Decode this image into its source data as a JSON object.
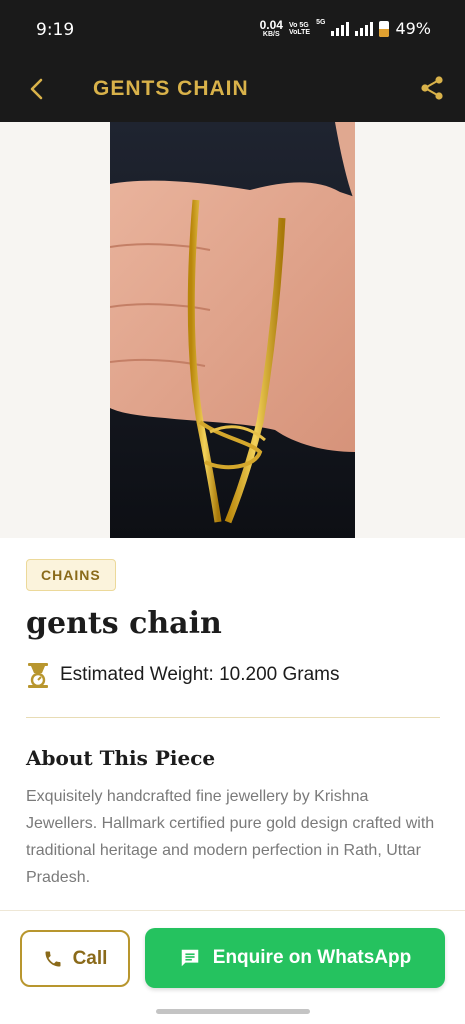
{
  "status_bar": {
    "time": "9:19",
    "net_speed_value": "0.04",
    "net_speed_unit": "KB/S",
    "volte_1": "Vo 5G",
    "volte_2": "VoLTE",
    "signal_label": "5G",
    "battery": "49%"
  },
  "app_bar": {
    "title": "GENTS CHAIN"
  },
  "product": {
    "category": "CHAINS",
    "name": "gents chain",
    "weight": "Estimated Weight: 10.200 Grams",
    "about_heading": "About This Piece",
    "about_text": "Exquisitely handcrafted fine jewellery by Krishna Jewellers. Hallmark certified pure gold design crafted with traditional heritage and modern perfection in Rath, Uttar Pradesh."
  },
  "actions": {
    "call_label": "Call",
    "whatsapp_label": "Enquire on WhatsApp"
  },
  "colors": {
    "app_bar_bg": "#1a1a1a",
    "gold_accent": "#d9b24a",
    "whatsapp_green": "#25c25f"
  },
  "icons": {
    "back": "chevron-left-icon",
    "share": "share-icon",
    "weight": "scale-icon",
    "call": "phone-icon",
    "whatsapp": "chat-icon"
  }
}
